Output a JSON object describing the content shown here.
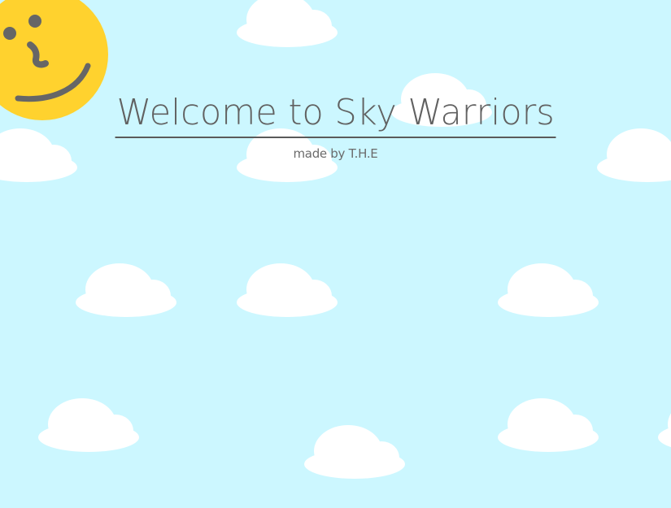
{
  "game": {
    "title": "Welcome to Sky Warriors",
    "credit": "made by T.H.E"
  },
  "colors": {
    "sky": "#ccf7ff",
    "cloud": "#ffffff",
    "sun": "#ffd22e",
    "sun_face": "#666666",
    "text": "#616161"
  }
}
